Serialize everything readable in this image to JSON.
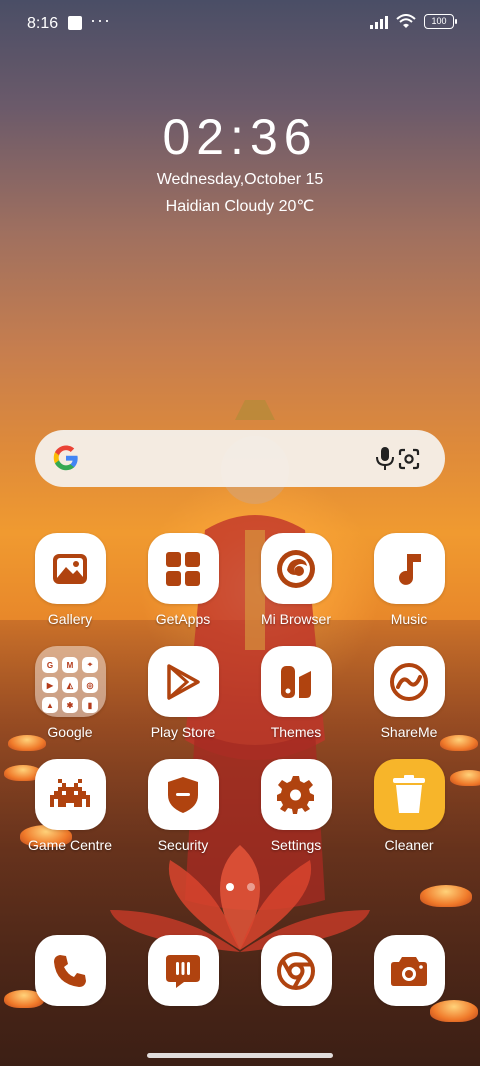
{
  "status_bar": {
    "time": "8:16",
    "battery": "100",
    "more": "···"
  },
  "lock_info": {
    "clock": "02:36",
    "date": "Wednesday,October 15",
    "weather": "Haidian Cloudy 20℃"
  },
  "search_bar": {
    "logo": "google-logo",
    "mic": "mic-icon",
    "lens": "lens-icon"
  },
  "apps": [
    {
      "label": "Gallery",
      "icon": "gallery-icon"
    },
    {
      "label": "GetApps",
      "icon": "getapps-icon"
    },
    {
      "label": "Mi Browser",
      "icon": "browser-icon"
    },
    {
      "label": "Music",
      "icon": "music-icon"
    },
    {
      "label": "Google",
      "icon": "google-folder-icon"
    },
    {
      "label": "Play Store",
      "icon": "play-store-icon"
    },
    {
      "label": "Themes",
      "icon": "themes-icon"
    },
    {
      "label": "ShareMe",
      "icon": "shareme-icon"
    },
    {
      "label": "Game Centre",
      "icon": "game-centre-icon"
    },
    {
      "label": "Security",
      "icon": "security-icon"
    },
    {
      "label": "Settings",
      "icon": "settings-icon"
    },
    {
      "label": "Cleaner",
      "icon": "cleaner-icon"
    }
  ],
  "folder_google": {
    "tiles": [
      "G",
      "M",
      "⌖",
      "▶",
      "◭",
      "◎",
      "▲",
      "✱",
      "▮"
    ]
  },
  "dock": [
    {
      "icon": "phone-icon"
    },
    {
      "icon": "messages-icon"
    },
    {
      "icon": "chrome-icon"
    },
    {
      "icon": "camera-icon"
    }
  ],
  "pager": {
    "pages": 2,
    "current": 1
  },
  "colors": {
    "icon_accent": "#b0430f",
    "tile_bg": "#ffffff",
    "cleaner_bg": "#f7b52a",
    "search_bg": "#f5f3f0"
  }
}
